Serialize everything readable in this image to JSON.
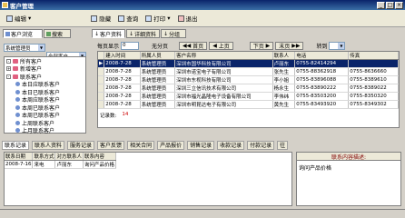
{
  "window": {
    "title": "客户管理",
    "min": "_",
    "max": "□",
    "close": "×"
  },
  "menu": [
    {
      "label": "编辑",
      "arrow": "▾"
    },
    {
      "label": "隐藏"
    },
    {
      "label": "查询"
    },
    {
      "label": "打印",
      "arrow": "▾"
    },
    {
      "label": "退出"
    }
  ],
  "left": {
    "tab_browse": "客户浏览",
    "tab_search": "搜索",
    "filter1": "系统管理员",
    "filter2": "全部客户",
    "tree": [
      {
        "label": "所有客户",
        "kind": "folder",
        "level": 0,
        "toggle": "-"
      },
      {
        "label": "新增客户",
        "kind": "folder",
        "level": 0,
        "toggle": "+"
      },
      {
        "label": "联系客户",
        "kind": "folder",
        "level": 0,
        "toggle": "-"
      },
      {
        "label": "本日应联系客户",
        "kind": "person",
        "level": 1
      },
      {
        "label": "本日已联系客户",
        "kind": "person",
        "level": 1
      },
      {
        "label": "本周应联系客户",
        "kind": "person",
        "level": 1
      },
      {
        "label": "本周已联系客户",
        "kind": "person",
        "level": 1
      },
      {
        "label": "本周已联系客户",
        "kind": "person",
        "level": 1
      },
      {
        "label": "上周联系客户",
        "kind": "person",
        "level": 1
      },
      {
        "label": "上月联系客户",
        "kind": "person",
        "level": 1
      }
    ]
  },
  "main_tabs": [
    "客户资料",
    "详细资料",
    "分组"
  ],
  "nav": {
    "per_page_label": "每页显示",
    "per_page_value": "0",
    "pages_label": "无分页",
    "first": "首页",
    "prev": "上页",
    "next": "下页",
    "last": "末页",
    "goto_label": "转到"
  },
  "grid": {
    "columns": [
      "建入时间",
      "所属人员",
      "客户名称",
      "联系人",
      "电话",
      "传真"
    ],
    "rows": [
      [
        "2008-7-28",
        "系统管理员",
        "深圳市国华科技有限公司",
        "卢丽东",
        "0755-82414294",
        ""
      ],
      [
        "2008-7-28",
        "系统管理员",
        "深圳市诺宝电子有限公司",
        "张先生",
        "0755-88362918",
        "0755-8636660"
      ],
      [
        "2008-7-28",
        "系统管理员",
        "深圳市东视科技有限公司",
        "李小姐",
        "0755-83896088",
        "0755-8389610"
      ],
      [
        "2008-7-28",
        "系统管理员",
        "深圳三立信讯技术有限公司",
        "杨永生",
        "0755-83890222",
        "0755-8389022"
      ],
      [
        "2008-7-28",
        "系统管理员",
        "深圳市福光晶隆电子设备有限公司",
        "李伟纬",
        "0755-83503200",
        "0755-8350320"
      ],
      [
        "2008-7-28",
        "系统管理员",
        "深圳市明昆达电子有限公司",
        "黄先生",
        "0755-83493920",
        "0755-8349302"
      ]
    ],
    "count_label": "记录数:",
    "count_value": "14"
  },
  "bottom_tabs": [
    "联系记录",
    "联系人资料",
    "服务记录",
    "客户反馈",
    "相关合同",
    "产品报价",
    "销售记录",
    "收款记录",
    "付款记录",
    "往"
  ],
  "bottom_grid": {
    "columns": [
      "联系日期",
      "联系方式",
      "对方联系人",
      "联系内容"
    ],
    "rows": [
      [
        "2008-7-16",
        "来电",
        "卢丽东",
        "询问产品价格"
      ]
    ]
  },
  "right_panel": {
    "title": "联系内容描述:",
    "content": "询问产品价格"
  }
}
